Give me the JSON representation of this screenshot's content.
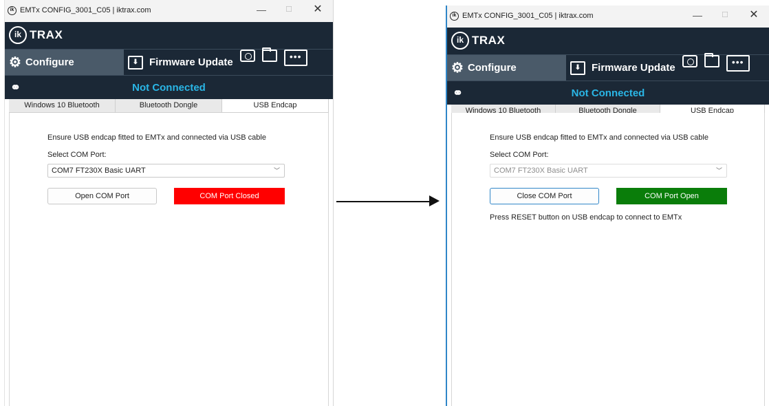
{
  "colors": {
    "brand_bg": "#1b2836",
    "nav_active_bg": "#4a5a69",
    "status_text": "#2ab6e6",
    "closed_red": "#ff0000",
    "open_green": "#0a7d0a"
  },
  "icons": [
    "ik-logo-icon",
    "minimize-icon",
    "maximize-icon",
    "close-icon",
    "gear-icon",
    "firmware-chip-icon",
    "camera-icon",
    "folder-icon",
    "more-icon",
    "link-icon",
    "chevron-down-icon",
    "arrow-right-icon"
  ],
  "windows": [
    {
      "title": "EMTx CONFIG_3001_C05 | iktrax.com",
      "brand": "TRAX",
      "brand_logo": "ik",
      "nav": {
        "configure": "Configure",
        "firmware": "Firmware Update",
        "more": "•••"
      },
      "status": "Not Connected",
      "tabs": [
        "Windows 10 Bluetooth",
        "Bluetooth Dongle",
        "USB Endcap"
      ],
      "active_tab": 2,
      "instruction": "Ensure USB endcap fitted to EMTx and connected via USB cable",
      "com_label": "Select COM Port:",
      "com_value": "COM7 FT230X Basic UART",
      "button_label": "Open COM Port",
      "status_box": "COM Port Closed",
      "status_box_color": "#ff0000",
      "message": ""
    },
    {
      "title": "EMTx CONFIG_3001_C05 | iktrax.com",
      "brand": "TRAX",
      "brand_logo": "ik",
      "nav": {
        "configure": "Configure",
        "firmware": "Firmware Update",
        "more": "•••"
      },
      "status": "Not Connected",
      "tabs": [
        "Windows 10 Bluetooth",
        "Bluetooth Dongle",
        "USB Endcap"
      ],
      "active_tab": 2,
      "instruction": "Ensure USB endcap fitted to EMTx and connected via USB cable",
      "com_label": "Select COM Port:",
      "com_value": "COM7 FT230X Basic UART",
      "button_label": "Close COM Port",
      "status_box": "COM Port Open",
      "status_box_color": "#0a7d0a",
      "message": "Press RESET button on USB endcap to connect to EMTx"
    }
  ]
}
